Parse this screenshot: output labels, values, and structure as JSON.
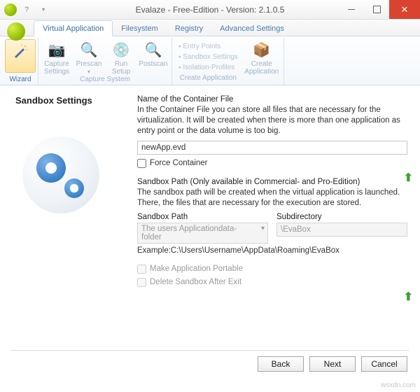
{
  "window": {
    "title": "Evalaze - Free-Edition - Version: 2.1.0.5"
  },
  "tabs": {
    "virtual_application": "Virtual Application",
    "filesystem": "Filesystem",
    "registry": "Registry",
    "advanced_settings": "Advanced Settings"
  },
  "ribbon": {
    "wizard": {
      "label": "Wizard",
      "group": "Wizard"
    },
    "capture_settings": "Capture\nSettings",
    "prescan": "Prescan",
    "run_setup": "Run\nSetup",
    "postscan": "Postscan",
    "capture_system_group": "Capture System",
    "entry_points": "Entry Points",
    "sandbox_settings": "Sandbox Settings",
    "isolation_profiles": "Isolation-Profiles",
    "create_application_group": "Create Application",
    "create_application": "Create\nApplication"
  },
  "page": {
    "heading": "Sandbox Settings",
    "container_label": "Name of the Container File",
    "container_desc": "In the Container File you can store all files that are necessary for the virtualization. It will be created when there is more than one application as entry point or the data volume is too big.",
    "container_value": "newApp.evd",
    "force_container": "Force Container",
    "sandbox_path_label": "Sandbox Path (Only available in Commercial- and Pro-Edition)",
    "sandbox_path_desc": "The sandbox path will be created when the virtual application is launched. There, the files that are necessary for the execution are stored.",
    "col_sandbox_path": "Sandbox Path",
    "col_subdirectory": "Subdirectory",
    "sandbox_path_value": "The users Applicationdata-folder",
    "subdirectory_value": "\\EvaBox",
    "example": "Example:C:\\Users\\Username\\AppData\\Roaming\\EvaBox",
    "make_portable": "Make Application Portable",
    "delete_after_exit": "Delete Sandbox After Exit"
  },
  "footer": {
    "back": "Back",
    "next": "Next",
    "cancel": "Cancel"
  },
  "watermark": "wsxdn.com"
}
